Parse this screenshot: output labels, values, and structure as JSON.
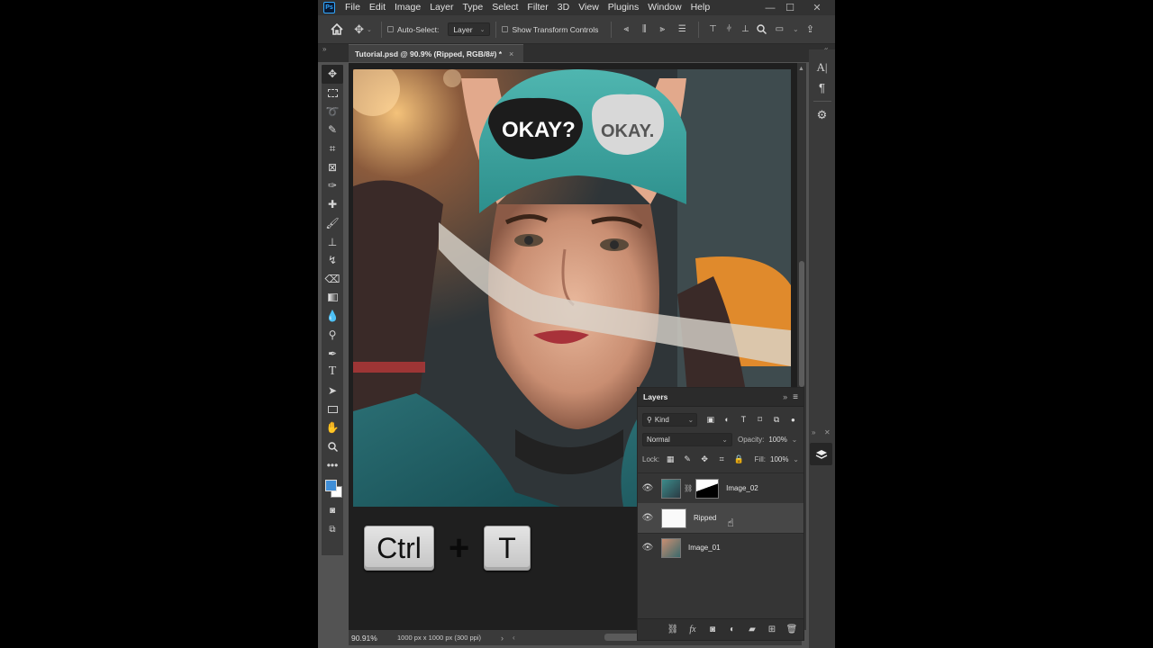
{
  "menu": {
    "app_icon": "Ps",
    "items": [
      "File",
      "Edit",
      "Image",
      "Layer",
      "Type",
      "Select",
      "Filter",
      "3D",
      "View",
      "Plugins",
      "Window",
      "Help"
    ]
  },
  "window_controls": {
    "minimize": "—",
    "maximize": "☐",
    "close": "✕"
  },
  "options_bar": {
    "auto_select_label": "Auto-Select:",
    "auto_select_target": "Layer",
    "show_transform_label": "Show Transform Controls"
  },
  "document": {
    "tab_title": "Tutorial.psd @ 90.9% (Ripped, RGB/8#) *",
    "tab_close": "×"
  },
  "shortcut": {
    "key1": "Ctrl",
    "plus": "+",
    "key2": "T"
  },
  "status": {
    "zoom": "90.91%",
    "doc_info": "1000 px x 1000 px (300 ppi)",
    "arrow": "›"
  },
  "layers_panel": {
    "title": "Layers",
    "filter_kind": "Kind",
    "blend_mode": "Normal",
    "opacity_label": "Opacity:",
    "opacity_value": "100%",
    "lock_label": "Lock:",
    "fill_label": "Fill:",
    "fill_value": "100%",
    "layers": [
      {
        "name": "Image_02",
        "visible": true,
        "selected": false
      },
      {
        "name": "Ripped",
        "visible": true,
        "selected": true
      },
      {
        "name": "Image_01",
        "visible": true,
        "selected": false
      }
    ]
  },
  "colors": {
    "foreground": "#3f8ed8",
    "background": "#ffffff",
    "accent": "#31a8ff"
  }
}
